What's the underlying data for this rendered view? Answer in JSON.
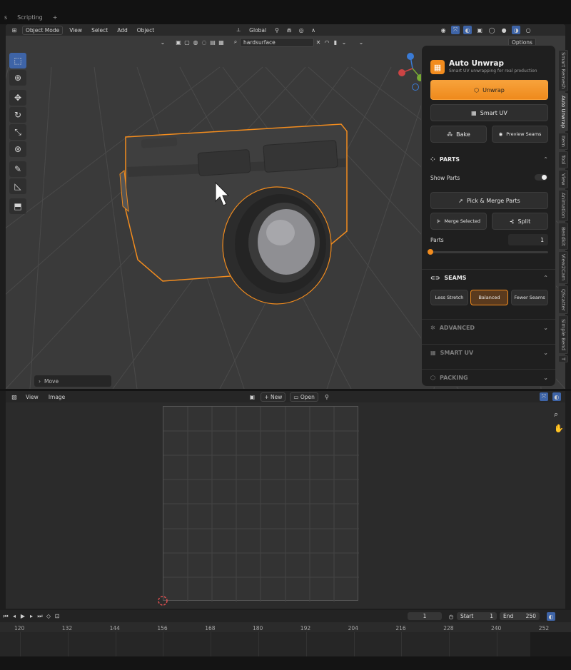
{
  "topbar": {
    "tabs": [
      "s",
      "Scripting",
      "+"
    ]
  },
  "viewport": {
    "header": {
      "mode": "Object Mode",
      "menus": [
        "View",
        "Select",
        "Add",
        "Object"
      ],
      "orientation": "Global",
      "options": "Options"
    },
    "search": {
      "value": "hardsurface"
    },
    "operator_panel": "Move",
    "gizmo": {
      "x": "X",
      "y": "Y",
      "z": "Z"
    }
  },
  "side_tabs": [
    "Smart Remesh",
    "Auto Unwrap",
    "Item",
    "Tool",
    "View",
    "Animation",
    "Bendkit",
    "View2Cam",
    "QScatter",
    "Simple Bend",
    "T"
  ],
  "panel": {
    "title": "Auto Unwrap",
    "subtitle": "Smart UV unwrapping for real production",
    "unwrap_label": "Unwrap",
    "smart_uv_label": "Smart UV",
    "bake_label": "Bake",
    "preview_seams_label": "Preview Seams",
    "parts": {
      "title": "PARTS",
      "show_parts_label": "Show Parts",
      "show_parts_on": true,
      "pick_merge_label": "Pick & Merge Parts",
      "merge_selected_label": "Merge Selected",
      "split_label": "Split",
      "parts_label": "Parts",
      "parts_value": "1",
      "parts_slider_fraction": 0.0
    },
    "seams": {
      "title": "SEAMS",
      "options": [
        "Less Stretch",
        "Balanced",
        "Fewer Seams"
      ],
      "selected": "Balanced"
    },
    "collapsed_sections": [
      "ADVANCED",
      "SMART UV",
      "PACKING"
    ]
  },
  "uv_editor": {
    "menus": [
      "View",
      "Image"
    ],
    "new_label": "New",
    "open_label": "Open"
  },
  "timeline": {
    "current_frame": "1",
    "start_label": "Start",
    "start_value": "1",
    "end_label": "End",
    "end_value": "250",
    "ticks": [
      "120",
      "132",
      "144",
      "156",
      "168",
      "180",
      "192",
      "204",
      "216",
      "228",
      "240",
      "252"
    ]
  },
  "colors": {
    "accent": "#f28c1e",
    "selection_outline": "#f28c1e",
    "active_tool": "#3e64a7"
  }
}
